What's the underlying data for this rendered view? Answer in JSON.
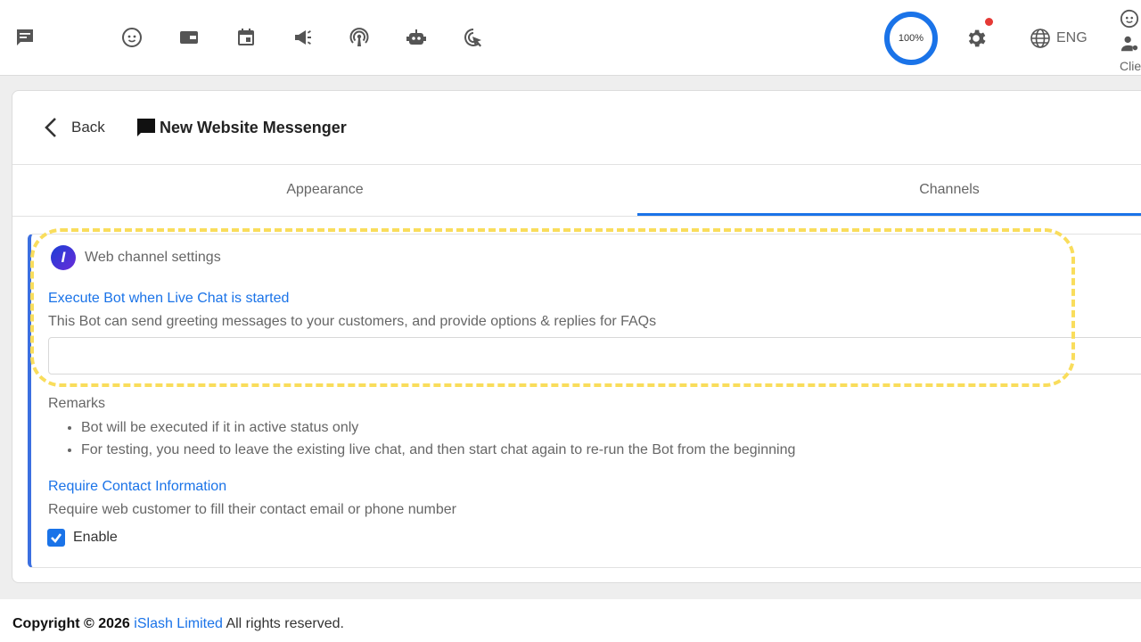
{
  "topbar": {
    "quota_label": "100%",
    "language": "ENG",
    "client_label": "Clie"
  },
  "header": {
    "back_label": "Back",
    "title": "New Website Messenger"
  },
  "tabs": [
    {
      "label": "Appearance",
      "active": false
    },
    {
      "label": "Channels",
      "active": true
    }
  ],
  "panel": {
    "title": "Web channel settings",
    "execute_bot": {
      "title": "Execute Bot when Live Chat is started",
      "description": "This Bot can send greeting messages to your customers, and provide options & replies for FAQs",
      "value": ""
    },
    "remarks": {
      "label": "Remarks",
      "items": [
        "Bot will be executed if it in active status only",
        "For testing, you need to leave the existing live chat, and then start chat again to re-run the Bot from the beginning"
      ]
    },
    "contact": {
      "title": "Require Contact Information",
      "description": "Require web customer to fill their contact email or phone number",
      "enable_label": "Enable",
      "enabled": true
    }
  },
  "footer": {
    "copyright": "Copyright © 2026",
    "company": "iSlash Limited",
    "rights": "All rights reserved."
  },
  "colors": {
    "accent": "#1a73e8",
    "highlight": "#f9dd5c",
    "notification": "#e53935"
  }
}
